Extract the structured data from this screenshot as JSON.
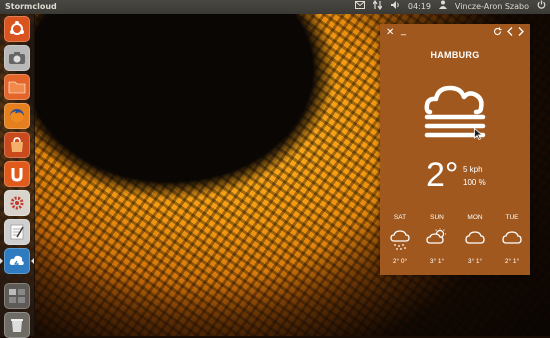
{
  "panel": {
    "app_title": "Stormcloud",
    "time": "04:19",
    "user": "Vincze-Aron Szabo"
  },
  "launcher": {
    "items": [
      "ubuntu-icon",
      "camera-icon",
      "folder-icon",
      "firefox-icon",
      "software-center-icon",
      "ubuntu-one-icon",
      "settings-icon",
      "text-editor-icon",
      "stormcloud-icon",
      "workspace-icon",
      "trash-icon"
    ]
  },
  "weather": {
    "city": "HAMBURG",
    "temperature": "2°",
    "wind": "5 kph",
    "humidity": "100 %",
    "forecast": [
      {
        "day": "SAT",
        "icon": "snow-cloud-icon",
        "temps": "2° 0°"
      },
      {
        "day": "SUN",
        "icon": "partly-cloudy-icon",
        "temps": "3° 1°"
      },
      {
        "day": "MON",
        "icon": "cloud-icon",
        "temps": "3° 1°"
      },
      {
        "day": "TUE",
        "icon": "cloud-icon",
        "temps": "2° 1°"
      }
    ]
  }
}
